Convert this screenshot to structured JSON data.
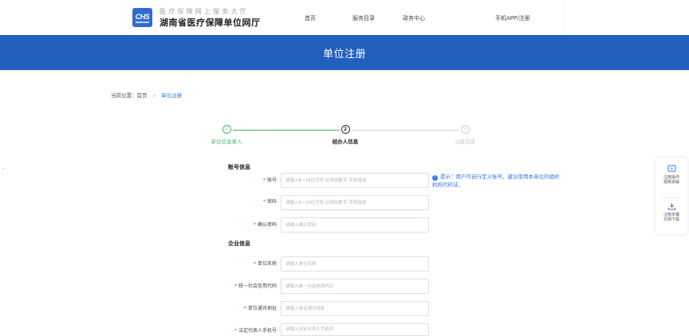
{
  "header": {
    "logo_text": "CHS",
    "brand_subtitle": "医疗保障网上服务大厅",
    "brand_title": "湖南省医疗保障单位网厅",
    "nav": [
      {
        "label": "首页"
      },
      {
        "label": "服务目录"
      },
      {
        "label": "政务中心"
      },
      {
        "label": "手机APP/注册"
      }
    ]
  },
  "banner": {
    "title": "单位注册"
  },
  "breadcrumb": {
    "prefix": "当前位置：",
    "home": "首页",
    "separator": ">",
    "current": "单位注册"
  },
  "stepper": {
    "steps": [
      {
        "number": "✓",
        "label": "单位信息录入",
        "state": "done"
      },
      {
        "number": "2",
        "label": "经办人信息",
        "state": "active"
      },
      {
        "number": "3",
        "label": "注册完成",
        "state": "pending"
      }
    ]
  },
  "form": {
    "account_section": "账号信息",
    "enterprise_section": "企业信息",
    "required_mark": "*",
    "fields": {
      "account": {
        "label": "账号",
        "placeholder": "请输入8~16位字符,必须由数字,字母组成",
        "value": ""
      },
      "password": {
        "label": "密码",
        "placeholder": "请输入8~16位字符,必须由数字,字母组成",
        "value": ""
      },
      "confirm_password": {
        "label": "确认密码",
        "placeholder": "请输入确认密码",
        "value": ""
      },
      "unit_name": {
        "label": "单位名称",
        "placeholder": "请输入单位名称",
        "value": ""
      },
      "credit_code": {
        "label": "统一社会信用代码",
        "placeholder": "请输入统一社会信用代码",
        "value": ""
      },
      "address": {
        "label": "单位通讯地址",
        "placeholder": "请输入单位通讯地址",
        "value": ""
      },
      "legal_phone": {
        "label": "法定代表人手机号",
        "placeholder": "请输入法定代表人手机号",
        "value": ""
      }
    },
    "tip": {
      "icon": "info-icon",
      "line1": "提示：用户可自行定义账号，建议使用本单位的组织",
      "line2": "机构代码证。"
    }
  },
  "side_panel": {
    "items": [
      {
        "icon": "video-icon",
        "line1": "注册操作",
        "line2": "视频讲解"
      },
      {
        "icon": "download-icon",
        "line1": "注册步骤",
        "line2": "文档下载"
      }
    ]
  },
  "colors": {
    "brand_blue": "#2160bd",
    "link_blue": "#2f78e0",
    "success_green": "#49b96a",
    "required_red": "#e0403a"
  }
}
